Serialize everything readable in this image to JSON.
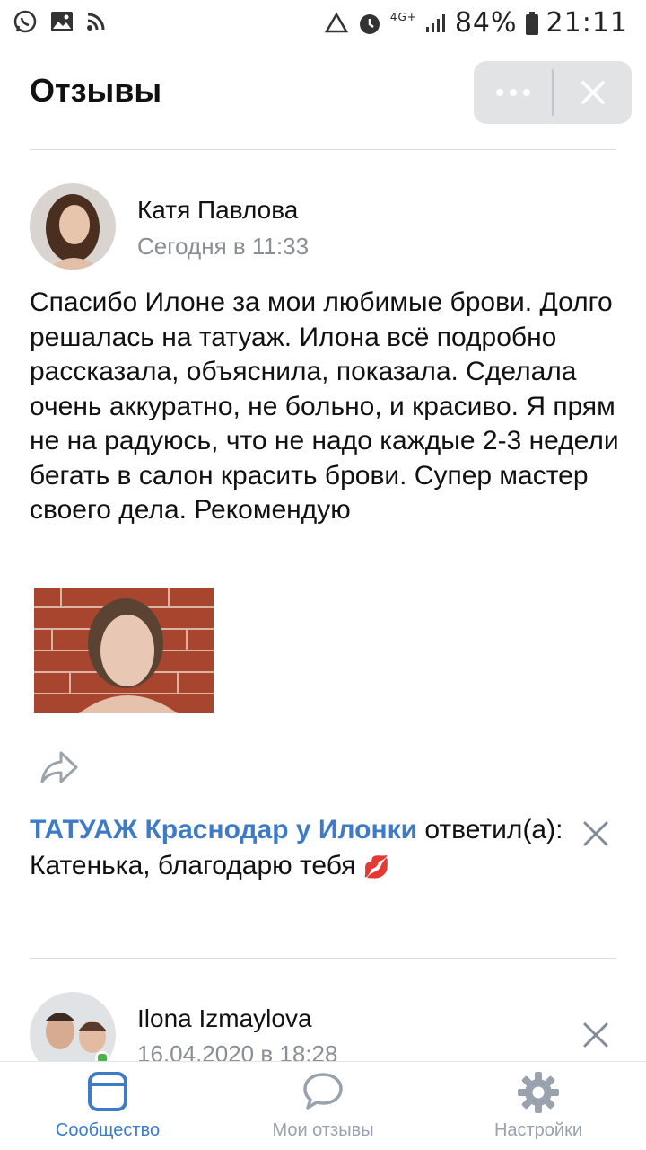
{
  "status_bar": {
    "battery": "84%",
    "time": "21:11",
    "network": "4G+"
  },
  "header": {
    "title": "Отзывы"
  },
  "review": {
    "author": "Катя Павлова",
    "time": "Сегодня в 11:33",
    "text": "Спасибо Илоне за мои любимые брови. Долго решалась на татуаж. Илона всё подробно рассказала, объяснила, показала. Сделала очень аккуратно, не больно, и красиво. Я прям не на радуюсь, что не надо каждые 2-3 недели бегать в салон красить брови. Супер мастер своего дела. Рекомендую"
  },
  "reply": {
    "author": "ТАТУАЖ Краснодар у Илонки",
    "verb": " ответил(а): ",
    "text": "Катенька, благодарю тебя",
    "emoji": "💋"
  },
  "review2": {
    "author": "Ilona Izmaylova",
    "time": "16.04.2020 в 18:28"
  },
  "nav": {
    "items": [
      {
        "label": "Сообщество",
        "icon": "community-icon",
        "active": true
      },
      {
        "label": "Мои отзывы",
        "icon": "chat-bubble-icon",
        "active": false
      },
      {
        "label": "Настройки",
        "icon": "gear-icon",
        "active": false
      }
    ]
  },
  "colors": {
    "accent": "#3e7bc7",
    "muted": "#99a2ad",
    "text": "#111111"
  }
}
